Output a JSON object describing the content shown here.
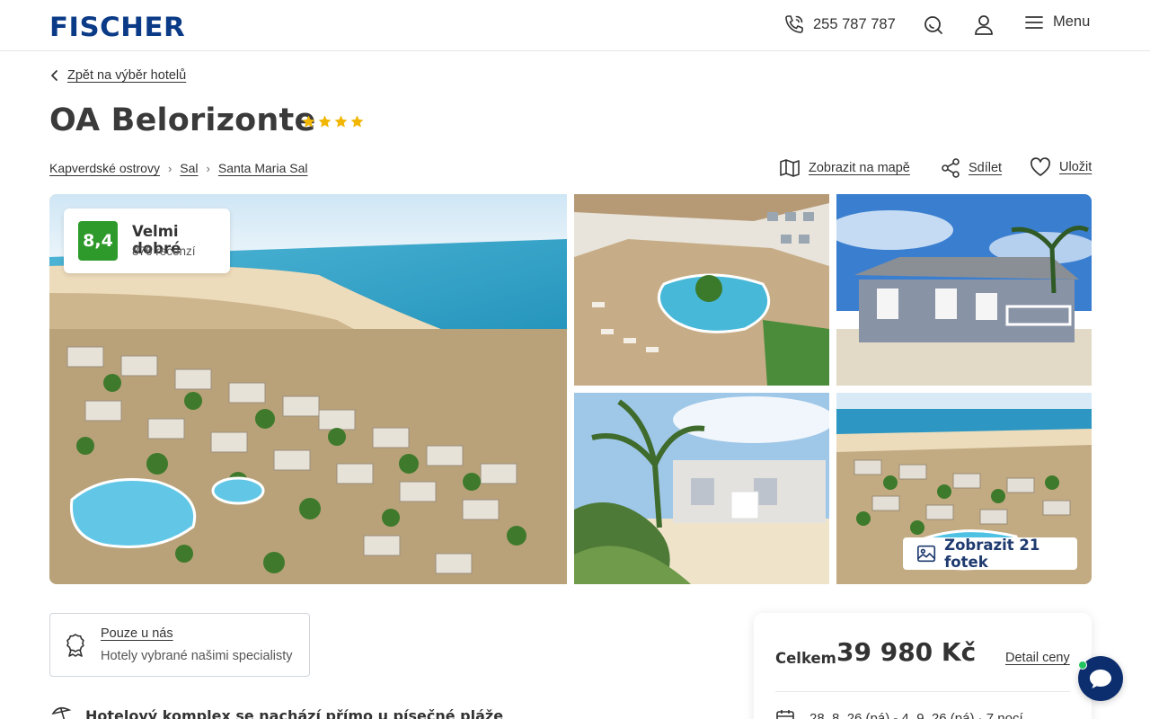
{
  "header": {
    "logo": "FISCHER",
    "phone": "255 787 787",
    "menu_label": "Menu"
  },
  "back_link": "Zpět na výběr hotelů",
  "hotel": {
    "name": "OA Belorizonte",
    "stars": 4
  },
  "breadcrumbs": [
    "Kapverdské ostrovy",
    "Sal",
    "Santa Maria Sal"
  ],
  "actions": {
    "map": "Zobrazit na mapě",
    "share": "Sdílet",
    "save": "Uložit"
  },
  "rating": {
    "score": "8,4",
    "verdict": "Velmi dobré",
    "reviews": "876 recenzí"
  },
  "gallery": {
    "show_photos": "Zobrazit 21 fotek"
  },
  "exclusive": {
    "title": "Pouze u nás",
    "subtitle": "Hotely vybrané našimi specialisty"
  },
  "feature": "Hotelový komplex se nachází přímo u písečné pláže",
  "price": {
    "label": "Celkem",
    "amount": "39 980 Kč",
    "detail": "Detail ceny",
    "dates": "28. 8. 26 (pá) - 4. 9. 26 (pá) · 7 nocí"
  },
  "colors": {
    "brand": "#0b3b87",
    "rating_green": "#2e9a2b",
    "star": "#f2b705",
    "chat": "#0d2e6e"
  }
}
